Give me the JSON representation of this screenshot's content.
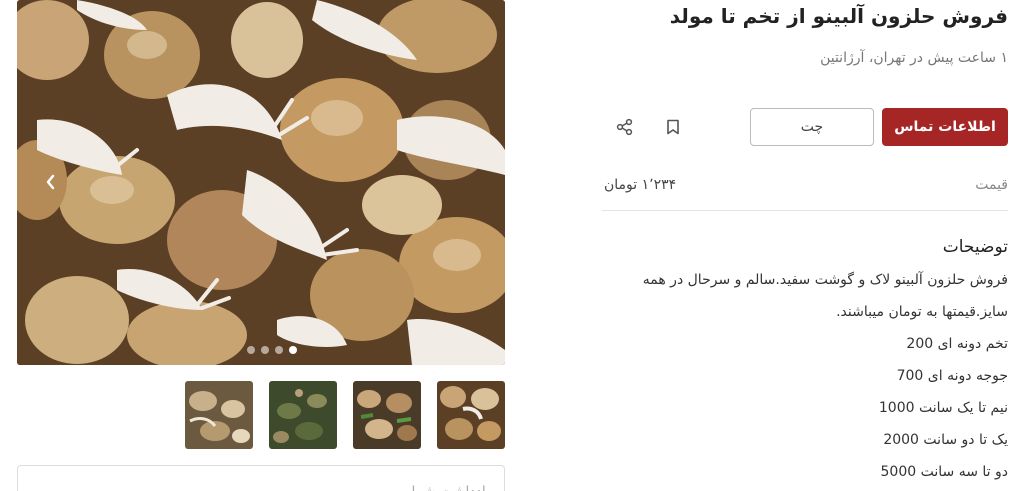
{
  "ad": {
    "title": "فروش حلزون آلبینو از تخم تا مولد",
    "subtitle": "۱ ساعت پیش در تهران، آرژانتین"
  },
  "actions": {
    "contact_label": "اطلاعات تماس",
    "chat_label": "چت",
    "bookmark_icon": "bookmark-icon",
    "share_icon": "share-icon"
  },
  "price": {
    "label": "قیمت",
    "value": "۱٬۲۳۴ تومان"
  },
  "description": {
    "heading": "توضیحات",
    "lines": [
      "فروش حلزون آلبینو لاک و گوشت سفید.سالم و سرحال در همه",
      "سایز.قیمتها به تومان میباشند.",
      "تخم دونه ای 200",
      "جوجه دونه ای 700",
      "نیم تا یک سانت 1000",
      "یک تا دو سانت 2000",
      "دو تا سه سانت 5000"
    ]
  },
  "gallery": {
    "prev_icon": "chevron-left-icon",
    "slide_count": 4,
    "active_slide": 4,
    "thumbnails": [
      "thumb-1",
      "thumb-2",
      "thumb-3",
      "thumb-4"
    ]
  },
  "note": {
    "placeholder": "یادداشت شما..."
  },
  "colors": {
    "primary": "#a62626",
    "border": "#e3e3e3",
    "muted_text": "#777777"
  }
}
